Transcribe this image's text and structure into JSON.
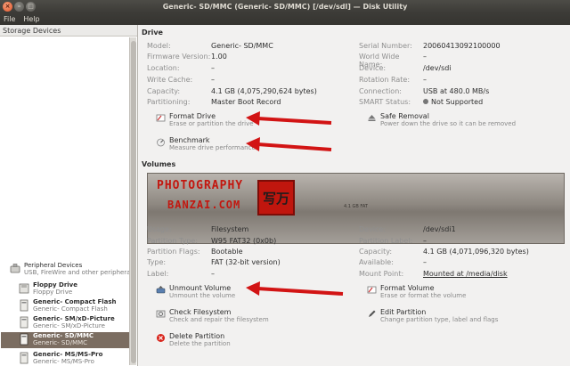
{
  "window": {
    "title": "Generic- SD/MMC (Generic- SD/MMC) [/dev/sdl] — Disk Utility"
  },
  "menu": [
    "File",
    "Help"
  ],
  "sidebar": {
    "header": "Storage Devices",
    "items": [
      {
        "title": "Peripheral Devices",
        "subtitle": "USB, FireWire and other peripherals"
      },
      {
        "title": "Floppy Drive",
        "subtitle": "Floppy Drive"
      },
      {
        "title": "Generic- Compact Flash",
        "subtitle": "Generic- Compact Flash"
      },
      {
        "title": "Generic- SM/xD-Picture",
        "subtitle": "Generic- SM/xD-Picture"
      },
      {
        "title": "Generic- SD/MMC",
        "subtitle": "Generic- SD/MMC"
      },
      {
        "title": "Generic- MS/MS-Pro",
        "subtitle": "Generic- MS/MS-Pro"
      }
    ]
  },
  "drive": {
    "title": "Drive",
    "left": [
      {
        "label": "Model:",
        "value": "Generic- SD/MMC"
      },
      {
        "label": "Firmware Version:",
        "value": "1.00"
      },
      {
        "label": "Location:",
        "value": "–"
      },
      {
        "label": "Write Cache:",
        "value": "–"
      },
      {
        "label": "Capacity:",
        "value": "4.1 GB (4,075,290,624 bytes)"
      },
      {
        "label": "Partitioning:",
        "value": "Master Boot Record"
      }
    ],
    "right": [
      {
        "label": "Serial Number:",
        "value": "20060413092100000"
      },
      {
        "label": "World Wide Name:",
        "value": "–"
      },
      {
        "label": "Device:",
        "value": "/dev/sdi"
      },
      {
        "label": "Rotation Rate:",
        "value": "–"
      },
      {
        "label": "Connection:",
        "value": "USB at 480.0 MB/s"
      },
      {
        "label": "SMART Status:",
        "value": "Not Supported"
      }
    ],
    "actions": [
      {
        "name": "Format Drive",
        "desc": "Erase or partition the drive"
      },
      {
        "name": "Safe Removal",
        "desc": "Power down the drive so it can be removed"
      },
      {
        "name": "Benchmark",
        "desc": "Measure drive performance"
      }
    ]
  },
  "volumes": {
    "title": "Volumes",
    "bar_size": "4.1 GB FAT",
    "left": [
      {
        "label": "Usage:",
        "value": "Filesystem"
      },
      {
        "label": "Partition Type:",
        "value": "W95 FAT32 (0x0b)"
      },
      {
        "label": "Partition Flags:",
        "value": "Bootable"
      },
      {
        "label": "Type:",
        "value": "FAT (32-bit version)"
      },
      {
        "label": "Label:",
        "value": "–"
      }
    ],
    "right": [
      {
        "label": "Device:",
        "value": "/dev/sdi1"
      },
      {
        "label": "Partition Label:",
        "value": "–"
      },
      {
        "label": "Capacity:",
        "value": "4.1 GB (4,071,096,320 bytes)"
      },
      {
        "label": "Available:",
        "value": "–"
      },
      {
        "label": "Mount Point:",
        "value": "Mounted at /media/disk"
      }
    ],
    "actions": [
      {
        "name": "Unmount Volume",
        "desc": "Unmount the volume"
      },
      {
        "name": "Format Volume",
        "desc": "Erase or format the volume"
      },
      {
        "name": "Check Filesystem",
        "desc": "Check and repair the filesystem"
      },
      {
        "name": "Edit Partition",
        "desc": "Change partition type, label and flags"
      },
      {
        "name": "Delete Partition",
        "desc": "Delete the partition"
      }
    ]
  },
  "watermark": {
    "line1": "PHOTOGRAPHY",
    "line2": "BANZAI.COM",
    "seal": "写万"
  },
  "colors": {
    "arrow": "#d21414",
    "selection": "#7b6d61",
    "titlebar": "#3c3b37"
  }
}
